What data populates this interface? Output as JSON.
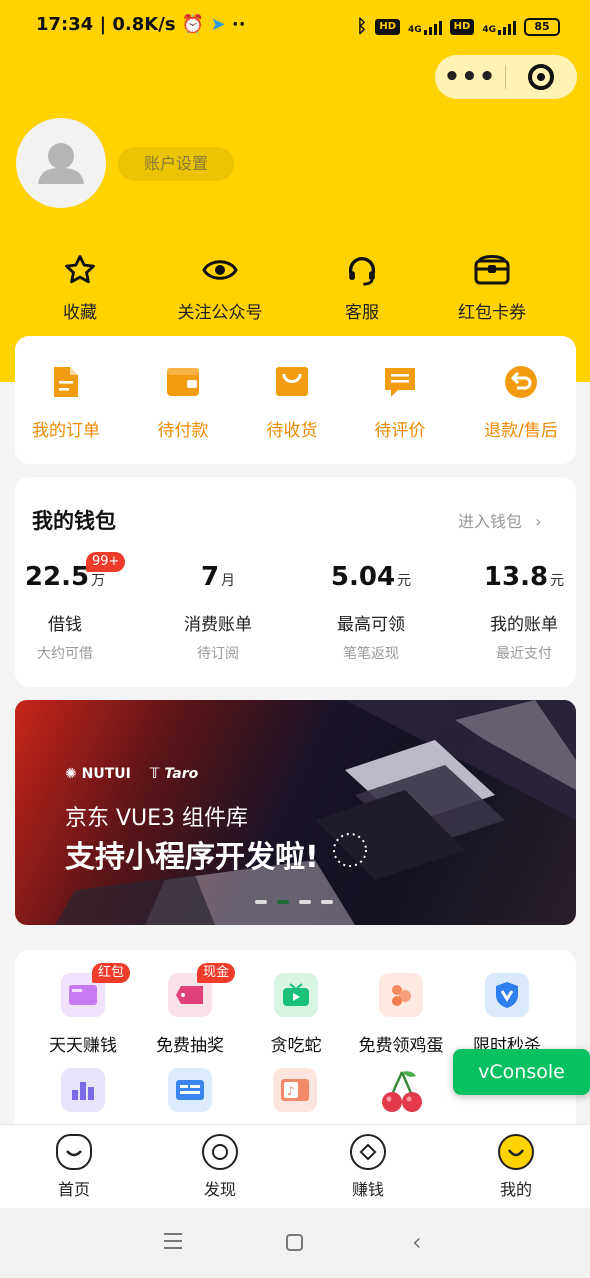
{
  "status_bar": {
    "time": "17:34",
    "speed": "0.8K/s",
    "battery": "85",
    "hd1": "HD",
    "hd2": "HD",
    "net1": "4G",
    "net2": "4G"
  },
  "capsule": {
    "more_icon": "more-dots-icon",
    "close_icon": "target-icon"
  },
  "profile": {
    "account_settings": "账户设置"
  },
  "quick_links": [
    {
      "label": "收藏",
      "icon": "star-icon"
    },
    {
      "label": "关注公众号",
      "icon": "eye-icon"
    },
    {
      "label": "客服",
      "icon": "headset-icon"
    },
    {
      "label": "红包卡券",
      "icon": "coupon-icon"
    }
  ],
  "orders": [
    {
      "label": "我的订单",
      "icon": "order-icon"
    },
    {
      "label": "待付款",
      "icon": "wallet-icon"
    },
    {
      "label": "待收货",
      "icon": "shopping-bag-icon"
    },
    {
      "label": "待评价",
      "icon": "comment-icon"
    },
    {
      "label": "退款/售后",
      "icon": "return-icon"
    }
  ],
  "wallet": {
    "title": "我的钱包",
    "enter_link": "进入钱包",
    "items": [
      {
        "value": "22.5",
        "unit": "万",
        "label": "借钱",
        "sub": "大约可借",
        "badge": "99+"
      },
      {
        "value": "7",
        "unit": "月",
        "label": "消费账单",
        "sub": "待订阅"
      },
      {
        "value": "5.04",
        "unit": "元",
        "label": "最高可领",
        "sub": "笔笔返现"
      },
      {
        "value": "13.8",
        "unit": "元",
        "label": "我的账单",
        "sub": "最近支付"
      }
    ]
  },
  "banner": {
    "brand1": "NUTUI",
    "brand2": "Taro",
    "line1": "京东 VUE3 组件库",
    "line2": "支持小程序开发啦!",
    "active_dot": 1
  },
  "games": [
    {
      "label": "天天赚钱",
      "badge": "红包",
      "icon": "vip-card-icon",
      "color": "#d9a8f5"
    },
    {
      "label": "免费抽奖",
      "badge": "现金",
      "icon": "ticket-icon",
      "color": "#f5c2cf"
    },
    {
      "label": "贪吃蛇",
      "icon": "tv-play-icon",
      "color": "#b9eccf"
    },
    {
      "label": "免费领鸡蛋",
      "icon": "eggs-icon",
      "color": "#fde2d6"
    },
    {
      "label": "限时秒杀",
      "icon": "shield-v-icon",
      "color": "#cfe3fb"
    },
    {
      "label": "",
      "icon": "bar-chart-icon",
      "color": "#dcd8f5"
    },
    {
      "label": "",
      "icon": "id-card-icon",
      "color": "#cfe1fa"
    },
    {
      "label": "",
      "icon": "music-card-icon",
      "color": "#fbd9cf"
    },
    {
      "label": "",
      "icon": "cherry-icon",
      "color": "#ffffff"
    }
  ],
  "vconsole": "vConsole",
  "tabs": [
    {
      "label": "首页",
      "icon": "home-icon"
    },
    {
      "label": "发现",
      "icon": "discover-icon"
    },
    {
      "label": "赚钱",
      "icon": "earn-icon"
    },
    {
      "label": "我的",
      "icon": "smile-icon"
    }
  ],
  "nav": {
    "menu": "menu-icon",
    "home": "square-icon",
    "back": "back-icon"
  }
}
